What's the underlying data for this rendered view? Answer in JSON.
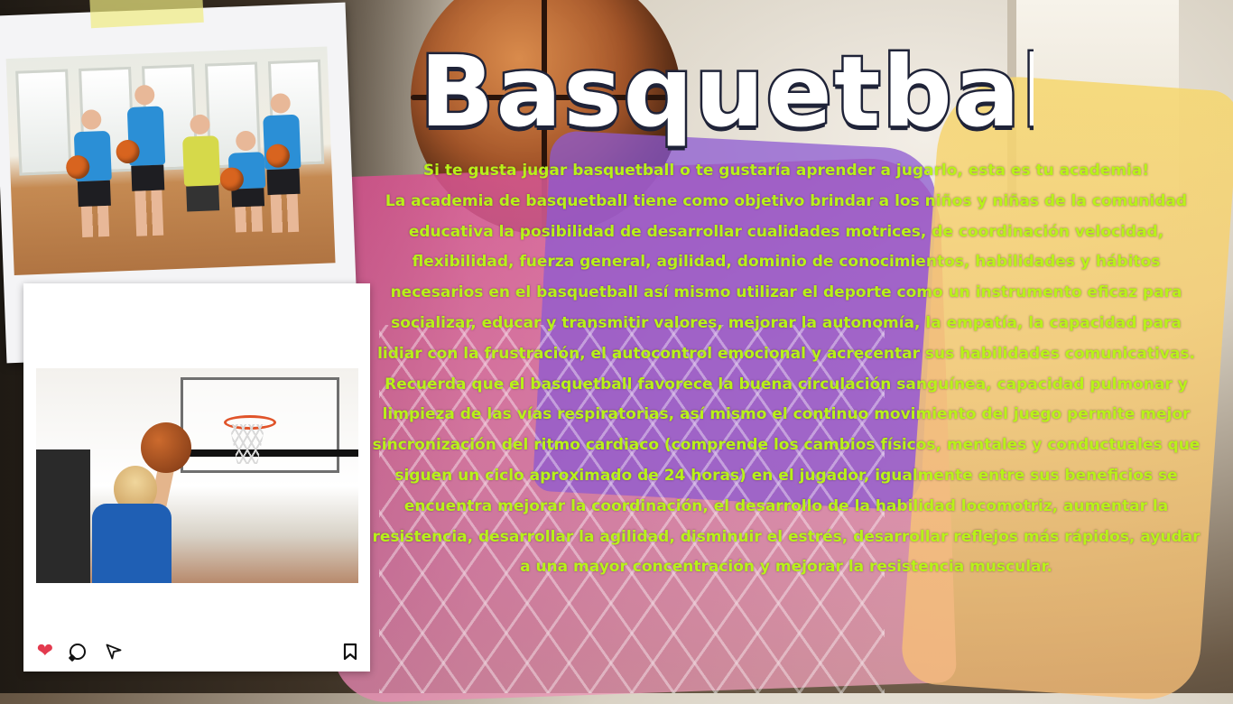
{
  "title": "Basquetball",
  "paragraphs": [
    "Si te gusta jugar basquetball o te gustaría aprender a jugarlo, esta es tu academia!",
    "La academia de basquetball tiene como objetivo brindar a los niños y niñas de la comunidad educativa la posibilidad de desarrollar cualidades motrices, de coordinación velocidad, flexibilidad, fuerza general, agilidad, dominio de conocimientos, habilidades y hábitos necesarios en el basquetball así mismo utilizar el deporte como un instrumento eficaz para socializar, educar y transmitir valores, mejorar la autonomía, la empatía, la capacidad para lidiar con la frustración, el autocontrol emocional y acrecentar sus habilidades comunicativas.",
    "Recuerda que el basquetball favorece la buena circulación sanguínea, capacidad pulmonar y limpieza de las vías respiratorias, así mismo el continuo movimiento del juego permite mejor sincronización del ritmo cardiaco (comprende los cambios físicos, mentales y conductuales que siguen un ciclo aproximado de 24 horas) en el jugador, igualmente entre sus beneficios se encuentra mejorar la coordinación, el desarrollo de la habilidad locomotriz, aumentar la resistencia, desarrollar la agilidad, disminuir el estrés, desarrollar reflejos más rápidos, ayudar a una mayor concentración y mejorar la resistencia muscular."
  ],
  "colors": {
    "body_text": "#b8f218",
    "title_fill": "#ffffff",
    "title_outline": "#1f2338",
    "heart": "#e33a4e"
  },
  "icons": {
    "like": "heart-icon",
    "comment": "comment-icon",
    "share": "send-icon",
    "save": "bookmark-icon"
  }
}
